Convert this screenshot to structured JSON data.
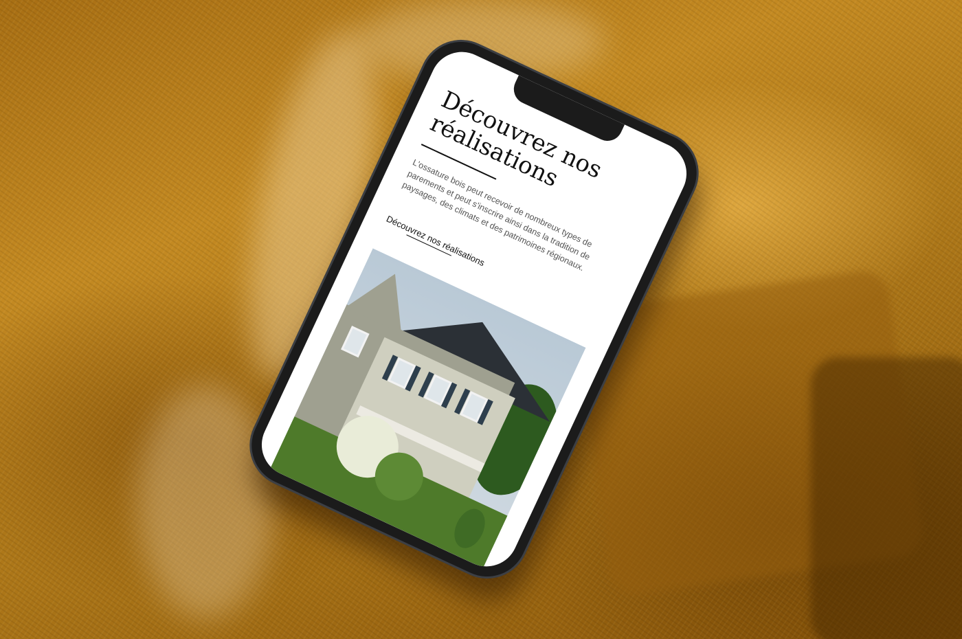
{
  "screen": {
    "title": "Découvrez nos réalisations",
    "body": "L'ossature bois peut recevoir de nombreux types de parements et peut s'inscrire ainsi dans la tradition de paysages, des climats et des patrimoines régionaux.",
    "link_label": "Découvrez nos réalisations"
  },
  "colors": {
    "fabric": "#b07a1a",
    "phone_frame": "#1b1b1b",
    "screen_bg": "#ffffff",
    "roof": "#2b3036",
    "siding": "#cfcfbf",
    "shutters": "#2e3f4d"
  },
  "icons": {
    "house_photo": "house-photo"
  }
}
